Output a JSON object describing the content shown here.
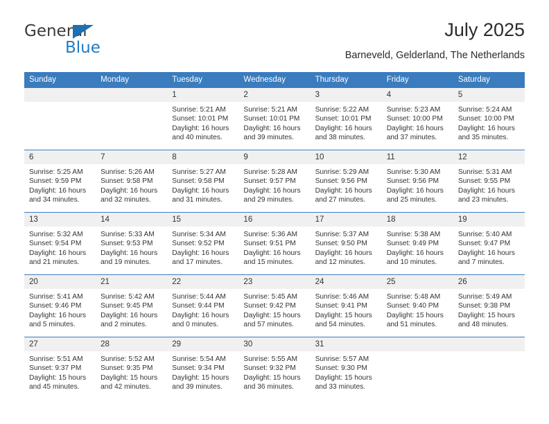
{
  "logo": {
    "word_top": "General",
    "word_bottom": "Blue",
    "triangle_icon": "triangle-icon",
    "color_blue": "#1f7cc4",
    "color_dark": "#3b3b3b"
  },
  "header": {
    "title": "July 2025",
    "subtitle": "Barneveld, Gelderland, The Netherlands"
  },
  "theme": {
    "header_bg": "#3a7cbe",
    "daynum_bg": "#f0f0f0",
    "rule": "#3a7cbe",
    "text": "#333333"
  },
  "calendar": {
    "weekday_headers": [
      "Sunday",
      "Monday",
      "Tuesday",
      "Wednesday",
      "Thursday",
      "Friday",
      "Saturday"
    ],
    "weeks": [
      [
        {
          "day": "",
          "lines": []
        },
        {
          "day": "",
          "lines": []
        },
        {
          "day": "1",
          "lines": [
            "Sunrise: 5:21 AM",
            "Sunset: 10:01 PM",
            "Daylight: 16 hours",
            "and 40 minutes."
          ]
        },
        {
          "day": "2",
          "lines": [
            "Sunrise: 5:21 AM",
            "Sunset: 10:01 PM",
            "Daylight: 16 hours",
            "and 39 minutes."
          ]
        },
        {
          "day": "3",
          "lines": [
            "Sunrise: 5:22 AM",
            "Sunset: 10:01 PM",
            "Daylight: 16 hours",
            "and 38 minutes."
          ]
        },
        {
          "day": "4",
          "lines": [
            "Sunrise: 5:23 AM",
            "Sunset: 10:00 PM",
            "Daylight: 16 hours",
            "and 37 minutes."
          ]
        },
        {
          "day": "5",
          "lines": [
            "Sunrise: 5:24 AM",
            "Sunset: 10:00 PM",
            "Daylight: 16 hours",
            "and 35 minutes."
          ]
        }
      ],
      [
        {
          "day": "6",
          "lines": [
            "Sunrise: 5:25 AM",
            "Sunset: 9:59 PM",
            "Daylight: 16 hours",
            "and 34 minutes."
          ]
        },
        {
          "day": "7",
          "lines": [
            "Sunrise: 5:26 AM",
            "Sunset: 9:58 PM",
            "Daylight: 16 hours",
            "and 32 minutes."
          ]
        },
        {
          "day": "8",
          "lines": [
            "Sunrise: 5:27 AM",
            "Sunset: 9:58 PM",
            "Daylight: 16 hours",
            "and 31 minutes."
          ]
        },
        {
          "day": "9",
          "lines": [
            "Sunrise: 5:28 AM",
            "Sunset: 9:57 PM",
            "Daylight: 16 hours",
            "and 29 minutes."
          ]
        },
        {
          "day": "10",
          "lines": [
            "Sunrise: 5:29 AM",
            "Sunset: 9:56 PM",
            "Daylight: 16 hours",
            "and 27 minutes."
          ]
        },
        {
          "day": "11",
          "lines": [
            "Sunrise: 5:30 AM",
            "Sunset: 9:56 PM",
            "Daylight: 16 hours",
            "and 25 minutes."
          ]
        },
        {
          "day": "12",
          "lines": [
            "Sunrise: 5:31 AM",
            "Sunset: 9:55 PM",
            "Daylight: 16 hours",
            "and 23 minutes."
          ]
        }
      ],
      [
        {
          "day": "13",
          "lines": [
            "Sunrise: 5:32 AM",
            "Sunset: 9:54 PM",
            "Daylight: 16 hours",
            "and 21 minutes."
          ]
        },
        {
          "day": "14",
          "lines": [
            "Sunrise: 5:33 AM",
            "Sunset: 9:53 PM",
            "Daylight: 16 hours",
            "and 19 minutes."
          ]
        },
        {
          "day": "15",
          "lines": [
            "Sunrise: 5:34 AM",
            "Sunset: 9:52 PM",
            "Daylight: 16 hours",
            "and 17 minutes."
          ]
        },
        {
          "day": "16",
          "lines": [
            "Sunrise: 5:36 AM",
            "Sunset: 9:51 PM",
            "Daylight: 16 hours",
            "and 15 minutes."
          ]
        },
        {
          "day": "17",
          "lines": [
            "Sunrise: 5:37 AM",
            "Sunset: 9:50 PM",
            "Daylight: 16 hours",
            "and 12 minutes."
          ]
        },
        {
          "day": "18",
          "lines": [
            "Sunrise: 5:38 AM",
            "Sunset: 9:49 PM",
            "Daylight: 16 hours",
            "and 10 minutes."
          ]
        },
        {
          "day": "19",
          "lines": [
            "Sunrise: 5:40 AM",
            "Sunset: 9:47 PM",
            "Daylight: 16 hours",
            "and 7 minutes."
          ]
        }
      ],
      [
        {
          "day": "20",
          "lines": [
            "Sunrise: 5:41 AM",
            "Sunset: 9:46 PM",
            "Daylight: 16 hours",
            "and 5 minutes."
          ]
        },
        {
          "day": "21",
          "lines": [
            "Sunrise: 5:42 AM",
            "Sunset: 9:45 PM",
            "Daylight: 16 hours",
            "and 2 minutes."
          ]
        },
        {
          "day": "22",
          "lines": [
            "Sunrise: 5:44 AM",
            "Sunset: 9:44 PM",
            "Daylight: 16 hours",
            "and 0 minutes."
          ]
        },
        {
          "day": "23",
          "lines": [
            "Sunrise: 5:45 AM",
            "Sunset: 9:42 PM",
            "Daylight: 15 hours",
            "and 57 minutes."
          ]
        },
        {
          "day": "24",
          "lines": [
            "Sunrise: 5:46 AM",
            "Sunset: 9:41 PM",
            "Daylight: 15 hours",
            "and 54 minutes."
          ]
        },
        {
          "day": "25",
          "lines": [
            "Sunrise: 5:48 AM",
            "Sunset: 9:40 PM",
            "Daylight: 15 hours",
            "and 51 minutes."
          ]
        },
        {
          "day": "26",
          "lines": [
            "Sunrise: 5:49 AM",
            "Sunset: 9:38 PM",
            "Daylight: 15 hours",
            "and 48 minutes."
          ]
        }
      ],
      [
        {
          "day": "27",
          "lines": [
            "Sunrise: 5:51 AM",
            "Sunset: 9:37 PM",
            "Daylight: 15 hours",
            "and 45 minutes."
          ]
        },
        {
          "day": "28",
          "lines": [
            "Sunrise: 5:52 AM",
            "Sunset: 9:35 PM",
            "Daylight: 15 hours",
            "and 42 minutes."
          ]
        },
        {
          "day": "29",
          "lines": [
            "Sunrise: 5:54 AM",
            "Sunset: 9:34 PM",
            "Daylight: 15 hours",
            "and 39 minutes."
          ]
        },
        {
          "day": "30",
          "lines": [
            "Sunrise: 5:55 AM",
            "Sunset: 9:32 PM",
            "Daylight: 15 hours",
            "and 36 minutes."
          ]
        },
        {
          "day": "31",
          "lines": [
            "Sunrise: 5:57 AM",
            "Sunset: 9:30 PM",
            "Daylight: 15 hours",
            "and 33 minutes."
          ]
        },
        {
          "day": "",
          "lines": []
        },
        {
          "day": "",
          "lines": []
        }
      ]
    ]
  }
}
